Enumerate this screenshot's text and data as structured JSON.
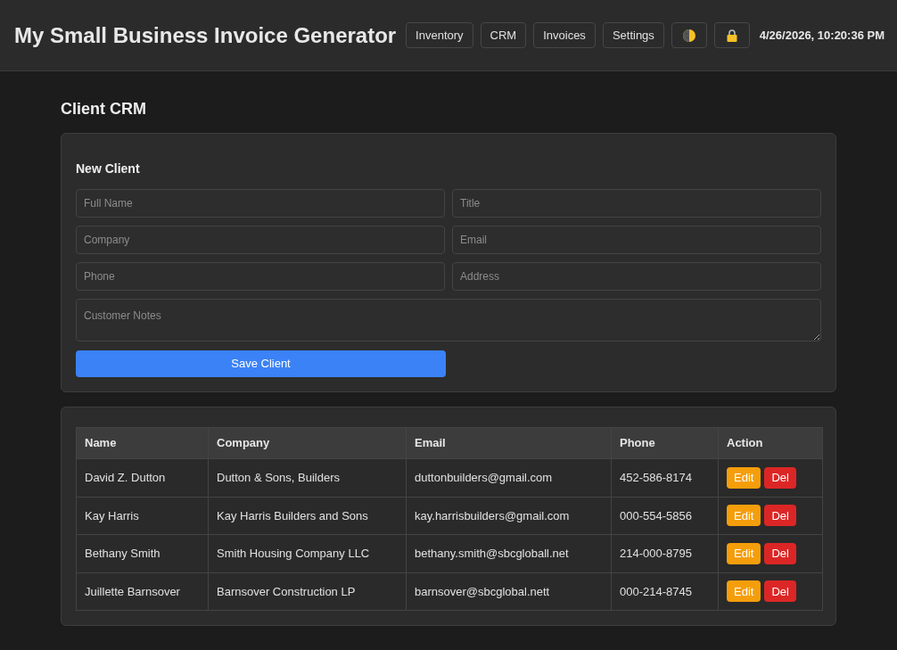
{
  "header": {
    "title": "My Small Business Invoice Generator",
    "nav": [
      {
        "label": "Inventory"
      },
      {
        "label": "CRM"
      },
      {
        "label": "Invoices"
      },
      {
        "label": "Settings"
      }
    ],
    "datetime": "4/26/2026, 10:20:36 PM"
  },
  "page": {
    "title": "Client CRM"
  },
  "form": {
    "title": "New Client",
    "fields": [
      {
        "placeholder": "Full Name"
      },
      {
        "placeholder": "Title"
      },
      {
        "placeholder": "Company"
      },
      {
        "placeholder": "Email"
      },
      {
        "placeholder": "Phone"
      },
      {
        "placeholder": "Address"
      }
    ],
    "notes": {
      "placeholder": "Customer Notes"
    },
    "submit": "Save Client"
  },
  "table": {
    "columns": [
      "Name",
      "Company",
      "Email",
      "Phone",
      "Action"
    ],
    "rows": [
      {
        "cells": [
          "David Z. Dutton",
          "Dutton & Sons, Builders",
          "duttonbuilders@gmail.com",
          "452-586-8174"
        ],
        "actions": [
          {
            "kind": "edit",
            "label": "Edit"
          },
          {
            "kind": "delete",
            "label": "Del"
          }
        ]
      },
      {
        "cells": [
          "Kay Harris",
          "Kay Harris Builders and Sons",
          "kay.harrisbuilders@gmail.com",
          "000-554-5856"
        ],
        "actions": [
          {
            "kind": "edit",
            "label": "Edit"
          },
          {
            "kind": "delete",
            "label": "Del"
          }
        ]
      },
      {
        "cells": [
          "Bethany Smith",
          "Smith Housing Company LLC",
          "bethany.smith@sbcgloball.net",
          "214-000-8795"
        ],
        "actions": [
          {
            "kind": "edit",
            "label": "Edit"
          },
          {
            "kind": "delete",
            "label": "Del"
          }
        ]
      },
      {
        "cells": [
          "Juillette Barnsover",
          "Barnsover Construction LP",
          "barnsover@sbcglobal.nett",
          "000-214-8745"
        ],
        "actions": [
          {
            "kind": "edit",
            "label": "Edit"
          },
          {
            "kind": "delete",
            "label": "Del"
          }
        ]
      }
    ]
  }
}
